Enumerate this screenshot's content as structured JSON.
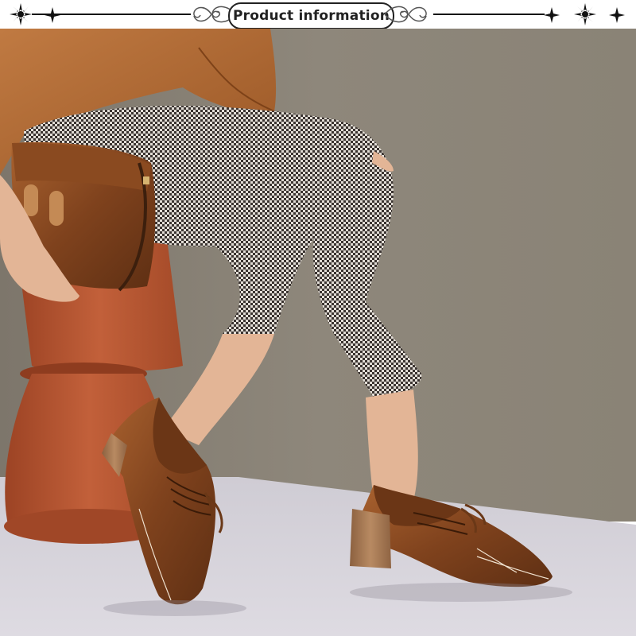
{
  "header": {
    "title": "Product information"
  },
  "icons": {
    "left_ornaments": [
      "star-ornament-icon",
      "small-star-ornament-icon"
    ],
    "right_ornaments": [
      "small-star-ornament-icon",
      "star-ornament-icon",
      "small-star-ornament-icon"
    ],
    "swirls": [
      "left-swirl-icon",
      "right-swirl-icon"
    ]
  },
  "colors": {
    "wall": "#8a8275",
    "floor": "#d8d4dc",
    "stool": "#b8532e",
    "leather": "#8e4e24",
    "heel_wood": "#a87a55",
    "trousers_dark": "#3a3330",
    "trousers_light": "#e2ddd6",
    "skin": "#e6b89a",
    "blouse": "#b06a33"
  }
}
